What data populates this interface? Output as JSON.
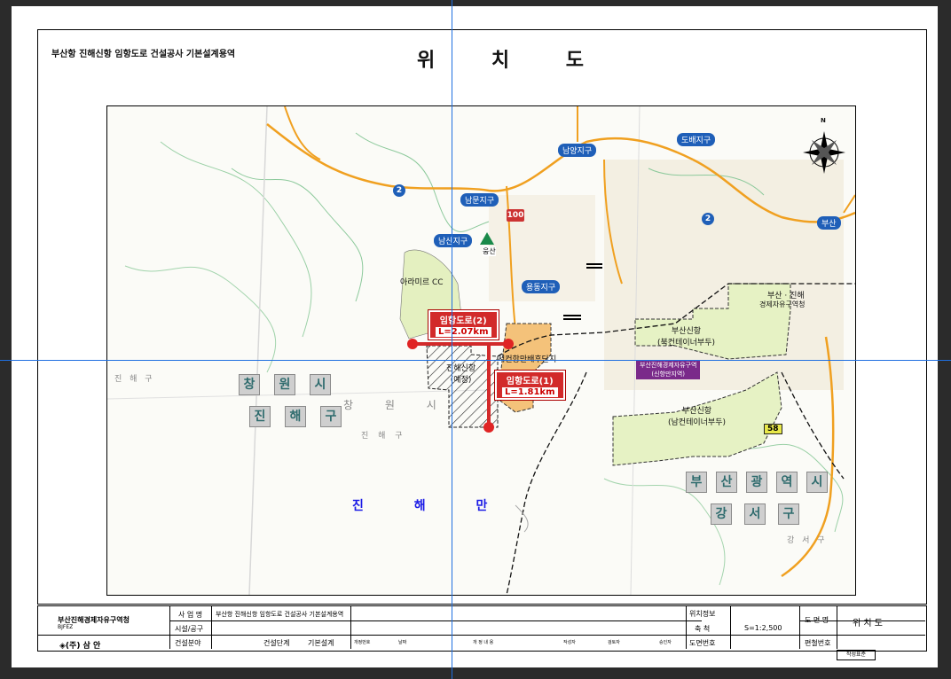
{
  "header": {
    "project_title": "부산항 진해신항 임항도로 건설공사 기본설계용역",
    "drawing_title": "위 치 도"
  },
  "map": {
    "north_label": "N",
    "districts": {
      "changwon_name": [
        "창",
        "원",
        "시"
      ],
      "changwon_gu": [
        "진",
        "해",
        "구"
      ],
      "busan_name": [
        "부",
        "산",
        "광",
        "역",
        "시"
      ],
      "busan_gu": [
        "강",
        "서",
        "구"
      ]
    },
    "sea_label": "진 해 만",
    "place_labels": {
      "arami_cc": "아라미르 CC",
      "seo_area": "서컨항만배후단지",
      "busan_jinhae": "부산 · 진해",
      "free_zone": "경제자유구역청",
      "north_port": "부산신항\n(북컨테이너부두)",
      "south_port": "부산신항\n(남컨테이너부두)",
      "jinhae_new": "진해신항\n(예정)",
      "jinhae_gu_left": "진 해 구",
      "changwon_faint": "창 원 시",
      "jinhae_gu_faint": "진 해 구",
      "gangseo_gu": "강 서 구"
    },
    "blue_badges": [
      "남양지구",
      "남문지구",
      "남산지구",
      "용동지구",
      "도배지구",
      "부산"
    ],
    "purple_badge": "부산진해경제자유구역\n(신항만지역)",
    "roads": {
      "route_2a": "2",
      "route_2b": "2",
      "route_100": "100",
      "route_58": "58"
    },
    "road_boxes": [
      {
        "title": "임항도로(2)",
        "length": "L=2.07km"
      },
      {
        "title": "임항도로(1)",
        "length": "L=1.81km"
      }
    ],
    "mountain_label": "웅산"
  },
  "title_block": {
    "org": "부산진해경제자유구역청",
    "org_abbr": "BJFEZ",
    "company": "◈(주) 삼 안",
    "business_name_label": "사 업 명",
    "business_name": "부산항 진해신항 임항도로 건설공사 기본설계용역",
    "facility_label": "시설/공구",
    "field_label": "건설분야",
    "stage_label": "건설단계",
    "stage_value": "기본설계",
    "rev_header": [
      "개정번호",
      "날짜",
      "개 정 내 용",
      "작성자",
      "검토자",
      "승인자"
    ],
    "position_info_label": "위치정보",
    "scale_label": "축 척",
    "scale_value": "S=1:2,500",
    "drawing_no_label": "도면번호",
    "drawing_name_label": "도 면 명",
    "drawing_name_value": "위 치 도",
    "compile_no_label": "편철번호",
    "stamp": "작성표준"
  },
  "colors": {
    "road_red": "#d22a2a",
    "zone_green": "#e6f2c4",
    "zone_orange": "#f4c27a",
    "guide_blue": "#1f6fe0",
    "badge_blue": "#1f5fb8"
  }
}
